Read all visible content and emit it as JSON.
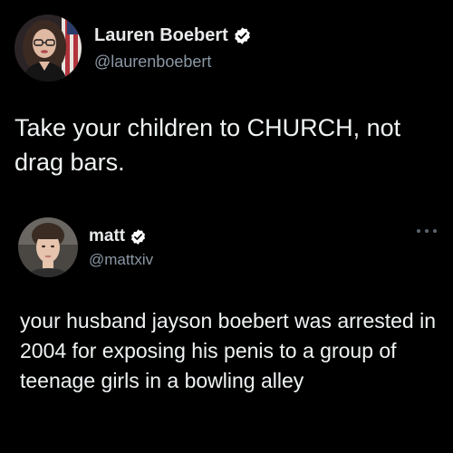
{
  "main_tweet": {
    "display_name": "Lauren Boebert",
    "handle": "@laurenboebert",
    "text": "Take your children to CHURCH, not drag bars.",
    "verified": true
  },
  "reply_tweet": {
    "display_name": "matt",
    "handle": "@mattxiv",
    "text": "your husband jayson boebert was arrested in 2004 for exposing his penis to a group of teenage girls in a bowling alley",
    "verified": true,
    "more_icon": "more-dots-icon"
  },
  "colors": {
    "background": "#000000",
    "text": "#e7e9ea",
    "secondary_text": "#8b98a5",
    "verified_badge": "#ffffff"
  }
}
